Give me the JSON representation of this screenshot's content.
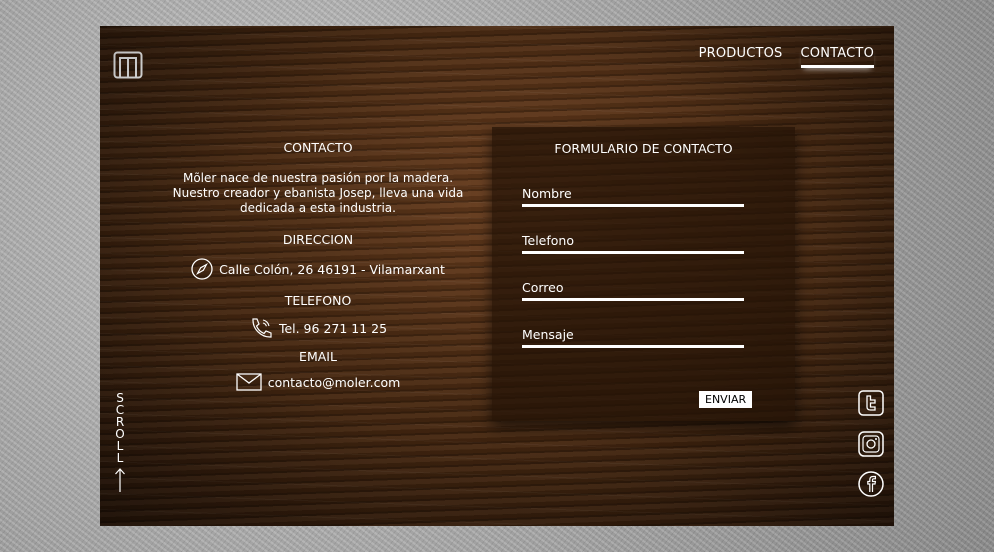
{
  "nav": {
    "items": [
      {
        "label": "PRODUCTOS",
        "active": false
      },
      {
        "label": "CONTACTO",
        "active": true
      }
    ]
  },
  "info": {
    "heading": "CONTACTO",
    "intro_lines": [
      "Mõler nace de nuestra pasión por la madera.",
      "Nuestro creador y ebanista Josep, lleva una vida",
      "dedicada a esta industria."
    ],
    "address_heading": "DIRECCION",
    "address": "Calle Colón, 26 46191 - Vilamarxant",
    "phone_heading": "TELEFONO",
    "phone": "Tel. 96 271 11 25",
    "email_heading": "EMAIL",
    "email": "contacto@moler.com"
  },
  "form": {
    "title": "FORMULARIO DE CONTACTO",
    "fields": [
      "Nombre",
      "Telefono",
      "Correo",
      "Mensaje"
    ],
    "submit_label": "ENVIAR"
  },
  "scroll": {
    "letters": [
      "S",
      "C",
      "R",
      "O",
      "L",
      "L"
    ]
  },
  "social": [
    "twitter-icon",
    "instagram-icon",
    "facebook-icon"
  ]
}
